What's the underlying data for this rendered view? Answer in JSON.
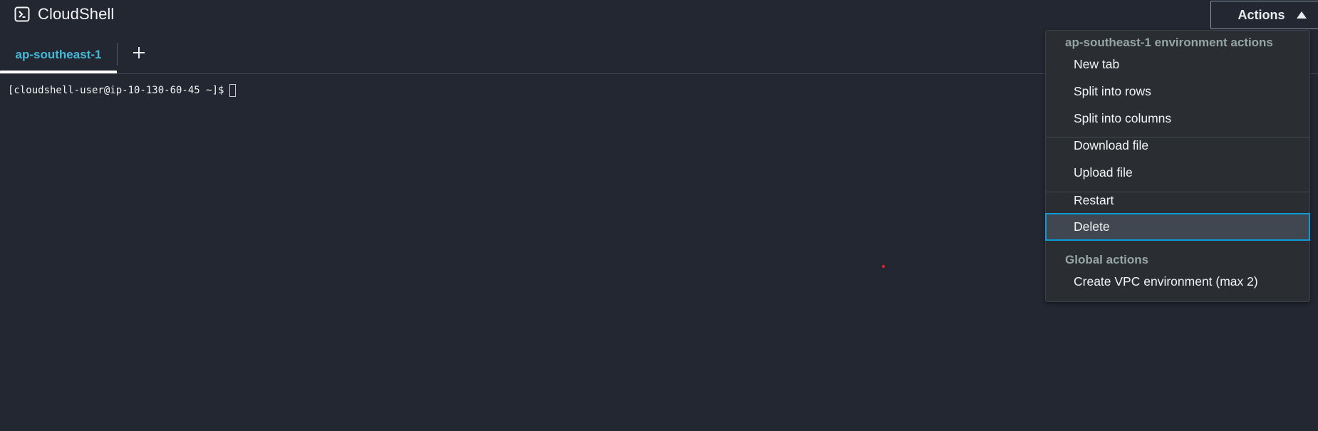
{
  "header": {
    "title": "CloudShell",
    "actions_label": "Actions"
  },
  "tabs": {
    "active_label": "ap-southeast-1",
    "add_icon": "plus-icon"
  },
  "terminal": {
    "prompt": "[cloudshell-user@ip-10-130-60-45 ~]$"
  },
  "menu": {
    "env_group_label": "ap-southeast-1 environment actions",
    "items": {
      "new_tab": "New tab",
      "split_rows": "Split into rows",
      "split_columns": "Split into columns",
      "download_file": "Download file",
      "upload_file": "Upload file",
      "restart": "Restart",
      "delete": "Delete"
    },
    "global_group_label": "Global actions",
    "create_vpc": "Create VPC environment (max 2)",
    "selected_item": "Delete"
  },
  "colors": {
    "background": "#232731",
    "accent": "#44b9d6",
    "focus_border": "#0a9ad4"
  }
}
